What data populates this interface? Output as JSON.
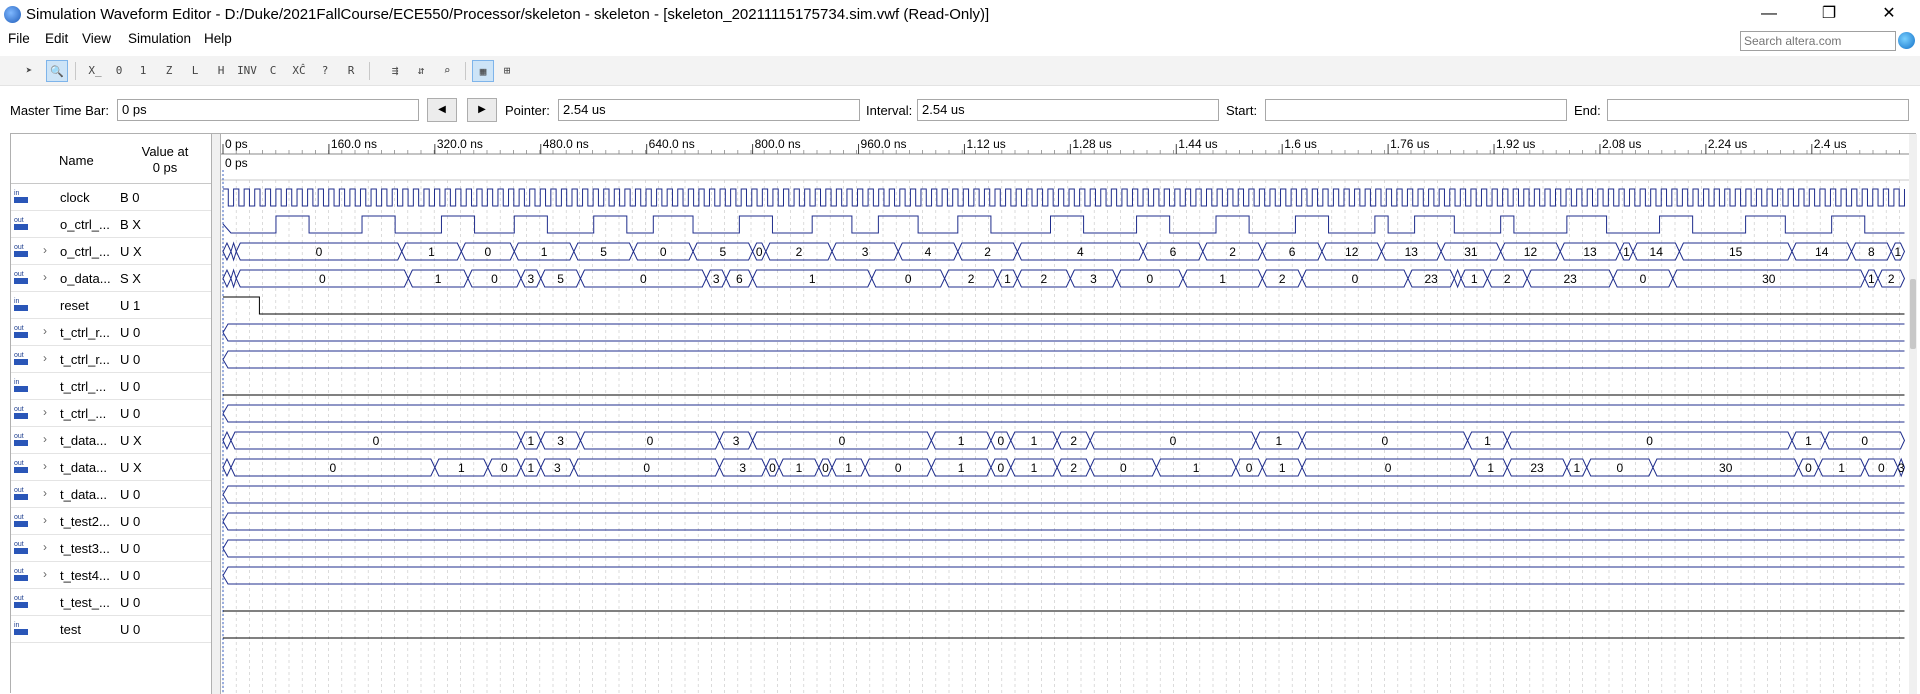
{
  "window": {
    "title": "Simulation Waveform Editor - D:/Duke/2021FallCourse/ECE550/Processor/skeleton - skeleton - [skeleton_20211115175734.sim.vwf (Read-Only)]",
    "icon": "simulator-app-icon",
    "controls": {
      "minimize": "—",
      "restore": "❐",
      "close": "✕"
    }
  },
  "menu": [
    "File",
    "Edit",
    "View",
    "Simulation",
    "Help"
  ],
  "search": {
    "placeholder": "Search altera.com"
  },
  "toolbar": [
    {
      "icon": "selection-tool-icon",
      "glyph": "➤",
      "active": false
    },
    {
      "icon": "zoom-tool-icon",
      "glyph": "🔍",
      "active": true
    },
    {
      "icon": "force-unknown-icon",
      "glyph": "X̲",
      "active": false
    },
    {
      "icon": "force-low-icon",
      "glyph": "0",
      "active": false
    },
    {
      "icon": "force-high-icon",
      "glyph": "1",
      "active": false
    },
    {
      "icon": "force-high-impedance-icon",
      "glyph": "Z",
      "active": false
    },
    {
      "icon": "weak-low-icon",
      "glyph": "L",
      "active": false
    },
    {
      "icon": "weak-high-icon",
      "glyph": "H",
      "active": false
    },
    {
      "icon": "invert-icon",
      "glyph": "INV",
      "active": false
    },
    {
      "icon": "count-value-icon",
      "glyph": "C",
      "active": false
    },
    {
      "icon": "clock-icon",
      "glyph": "XĈ",
      "active": false
    },
    {
      "icon": "arbitrary-value-icon",
      "glyph": "?",
      "active": false
    },
    {
      "icon": "random-value-icon",
      "glyph": "R",
      "active": false
    },
    {
      "icon": "snap-to-grid-icon",
      "glyph": "⇶",
      "active": false
    },
    {
      "icon": "sort-icon",
      "glyph": "⇵",
      "active": false
    },
    {
      "icon": "node-finder-icon",
      "glyph": "⌕",
      "active": false
    },
    {
      "icon": "run-functional-simulation-icon",
      "glyph": "▦",
      "active": true
    },
    {
      "icon": "run-timing-simulation-icon",
      "glyph": "⊞",
      "active": false
    }
  ],
  "timebar": {
    "master_label": "Master Time Bar:",
    "master_value": "0 ps",
    "pointer_label": "Pointer:",
    "pointer_value": "2.54 us",
    "interval_label": "Interval:",
    "interval_value": "2.54 us",
    "start_label": "Start:",
    "start_value": "",
    "end_label": "End:",
    "end_value": ""
  },
  "table": {
    "name_header": "Name",
    "value_header_line1": "Value at",
    "value_header_line2": "0 ps"
  },
  "ruler": {
    "labels": [
      "0 ps",
      "160.0 ns",
      "320.0 ns",
      "480.0 ns",
      "640.0 ns",
      "800.0 ns",
      "960.0 ns",
      "1.12 us",
      "1.28 us",
      "1.44 us",
      "1.6 us",
      "1.76 us",
      "1.92 us",
      "2.08 us",
      "2.24 us",
      "2.4 us",
      "2"
    ],
    "cursor_label": "0 ps"
  },
  "signals": [
    {
      "dir": "in",
      "name": "clock",
      "value": "B 0",
      "expandable": false
    },
    {
      "dir": "out",
      "name": "o_ctrl_...",
      "value": "B X",
      "expandable": false
    },
    {
      "dir": "out",
      "name": "o_ctrl_...",
      "value": "U X",
      "expandable": true
    },
    {
      "dir": "out",
      "name": "o_data...",
      "value": "S X",
      "expandable": true
    },
    {
      "dir": "in",
      "name": "reset",
      "value": "U 1",
      "expandable": false
    },
    {
      "dir": "out",
      "name": "t_ctrl_r...",
      "value": "U 0",
      "expandable": true
    },
    {
      "dir": "out",
      "name": "t_ctrl_r...",
      "value": "U 0",
      "expandable": true
    },
    {
      "dir": "in",
      "name": "t_ctrl_...",
      "value": "U 0",
      "expandable": false
    },
    {
      "dir": "out",
      "name": "t_ctrl_...",
      "value": "U 0",
      "expandable": true
    },
    {
      "dir": "out",
      "name": "t_data...",
      "value": "U X",
      "expandable": true
    },
    {
      "dir": "out",
      "name": "t_data...",
      "value": "U X",
      "expandable": true
    },
    {
      "dir": "out",
      "name": "t_data...",
      "value": "U 0",
      "expandable": true
    },
    {
      "dir": "out",
      "name": "t_test2...",
      "value": "U 0",
      "expandable": true
    },
    {
      "dir": "out",
      "name": "t_test3...",
      "value": "U 0",
      "expandable": true
    },
    {
      "dir": "out",
      "name": "t_test4...",
      "value": "U 0",
      "expandable": true
    },
    {
      "dir": "out",
      "name": "t_test_...",
      "value": "U 0",
      "expandable": false
    },
    {
      "dir": "in",
      "name": "test",
      "value": "U 0",
      "expandable": false
    }
  ],
  "waveforms": {
    "time_end_us": 2.54,
    "colors": {
      "wave": "#1f2d8c",
      "grid": "#c4c4c4",
      "line": "#000000"
    },
    "clock_cycles": 159,
    "clock_first_level": 1,
    "reset_high_until_us": 0.055,
    "ctrl_toggle_us": [
      0.08,
      0.13,
      0.21,
      0.26,
      0.33,
      0.38,
      0.44,
      0.49,
      0.56,
      0.61,
      0.65,
      0.71,
      0.78,
      0.83,
      0.89,
      0.95,
      0.99,
      1.05,
      1.11,
      1.16,
      1.25,
      1.3,
      1.38,
      1.43,
      1.5,
      1.55,
      1.62,
      1.67,
      1.74,
      1.76,
      1.8,
      1.86,
      1.93,
      1.95,
      2.03,
      2.09,
      2.17,
      2.22,
      2.3,
      2.36,
      2.43,
      2.48
    ],
    "buses": [
      {
        "row": 2,
        "segments": [
          [
            0.0,
            0.012,
            ""
          ],
          [
            0.012,
            0.02,
            ""
          ],
          [
            0.02,
            0.27,
            "0"
          ],
          [
            0.27,
            0.36,
            "1"
          ],
          [
            0.36,
            0.44,
            "0"
          ],
          [
            0.44,
            0.53,
            "1"
          ],
          [
            0.53,
            0.62,
            "5"
          ],
          [
            0.62,
            0.71,
            "0"
          ],
          [
            0.71,
            0.8,
            "5"
          ],
          [
            0.8,
            0.82,
            "0"
          ],
          [
            0.82,
            0.92,
            "2"
          ],
          [
            0.92,
            1.02,
            "3"
          ],
          [
            1.02,
            1.11,
            "4"
          ],
          [
            1.11,
            1.2,
            "2"
          ],
          [
            1.2,
            1.39,
            "4"
          ],
          [
            1.39,
            1.48,
            "6"
          ],
          [
            1.48,
            1.57,
            "2"
          ],
          [
            1.57,
            1.66,
            "6"
          ],
          [
            1.66,
            1.75,
            "12"
          ],
          [
            1.75,
            1.84,
            "13"
          ],
          [
            1.84,
            1.93,
            "31"
          ],
          [
            1.93,
            2.02,
            "12"
          ],
          [
            2.02,
            2.11,
            "13"
          ],
          [
            2.11,
            2.13,
            "1"
          ],
          [
            2.13,
            2.2,
            "14"
          ],
          [
            2.2,
            2.37,
            "15"
          ],
          [
            2.37,
            2.46,
            "14"
          ],
          [
            2.46,
            2.52,
            "8"
          ],
          [
            2.52,
            2.54,
            "1"
          ]
        ]
      },
      {
        "row": 3,
        "segments": [
          [
            0.0,
            0.012,
            ""
          ],
          [
            0.012,
            0.02,
            ""
          ],
          [
            0.02,
            0.28,
            "0"
          ],
          [
            0.28,
            0.37,
            "1"
          ],
          [
            0.37,
            0.45,
            "0"
          ],
          [
            0.45,
            0.48,
            "3"
          ],
          [
            0.48,
            0.54,
            "5"
          ],
          [
            0.54,
            0.73,
            "0"
          ],
          [
            0.73,
            0.76,
            "3"
          ],
          [
            0.76,
            0.8,
            "6"
          ],
          [
            0.8,
            0.98,
            "1"
          ],
          [
            0.98,
            1.09,
            "0"
          ],
          [
            1.09,
            1.17,
            "2"
          ],
          [
            1.17,
            1.2,
            "1"
          ],
          [
            1.2,
            1.28,
            "2"
          ],
          [
            1.28,
            1.35,
            "3"
          ],
          [
            1.35,
            1.45,
            "0"
          ],
          [
            1.45,
            1.57,
            "1"
          ],
          [
            1.57,
            1.63,
            "2"
          ],
          [
            1.63,
            1.79,
            "0"
          ],
          [
            1.79,
            1.86,
            "23"
          ],
          [
            1.86,
            1.87,
            ""
          ],
          [
            1.87,
            1.91,
            "1"
          ],
          [
            1.91,
            1.97,
            "2"
          ],
          [
            1.97,
            2.1,
            "23"
          ],
          [
            2.1,
            2.19,
            "0"
          ],
          [
            2.19,
            2.48,
            "30"
          ],
          [
            2.48,
            2.5,
            "1"
          ],
          [
            2.5,
            2.54,
            "2"
          ]
        ]
      },
      {
        "row": 9,
        "segments": [
          [
            0.0,
            0.012,
            ""
          ],
          [
            0.012,
            0.45,
            "0"
          ],
          [
            0.45,
            0.48,
            "1"
          ],
          [
            0.48,
            0.54,
            "3"
          ],
          [
            0.54,
            0.75,
            "0"
          ],
          [
            0.75,
            0.8,
            "3"
          ],
          [
            0.8,
            1.07,
            "0"
          ],
          [
            1.07,
            1.16,
            "1"
          ],
          [
            1.16,
            1.19,
            "0"
          ],
          [
            1.19,
            1.26,
            "1"
          ],
          [
            1.26,
            1.31,
            "2"
          ],
          [
            1.31,
            1.56,
            "0"
          ],
          [
            1.56,
            1.63,
            "1"
          ],
          [
            1.63,
            1.88,
            "0"
          ],
          [
            1.88,
            1.94,
            "1"
          ],
          [
            1.94,
            2.37,
            "0"
          ],
          [
            2.37,
            2.42,
            "1"
          ],
          [
            2.42,
            2.54,
            "0"
          ]
        ]
      },
      {
        "row": 10,
        "segments": [
          [
            0.0,
            0.012,
            ""
          ],
          [
            0.012,
            0.32,
            "0"
          ],
          [
            0.32,
            0.4,
            "1"
          ],
          [
            0.4,
            0.45,
            "0"
          ],
          [
            0.45,
            0.48,
            "1"
          ],
          [
            0.48,
            0.53,
            "3"
          ],
          [
            0.53,
            0.75,
            "0"
          ],
          [
            0.75,
            0.82,
            "3"
          ],
          [
            0.82,
            0.84,
            "0"
          ],
          [
            0.84,
            0.9,
            "1"
          ],
          [
            0.9,
            0.92,
            "0"
          ],
          [
            0.92,
            0.97,
            "1"
          ],
          [
            0.97,
            1.07,
            "0"
          ],
          [
            1.07,
            1.16,
            "1"
          ],
          [
            1.16,
            1.19,
            "0"
          ],
          [
            1.19,
            1.26,
            "1"
          ],
          [
            1.26,
            1.31,
            "2"
          ],
          [
            1.31,
            1.41,
            "0"
          ],
          [
            1.41,
            1.53,
            "1"
          ],
          [
            1.53,
            1.57,
            "0"
          ],
          [
            1.57,
            1.63,
            "1"
          ],
          [
            1.63,
            1.89,
            "0"
          ],
          [
            1.89,
            1.94,
            "1"
          ],
          [
            1.94,
            2.03,
            "23"
          ],
          [
            2.03,
            2.06,
            "1"
          ],
          [
            2.06,
            2.16,
            "0"
          ],
          [
            2.16,
            2.38,
            "30"
          ],
          [
            2.38,
            2.41,
            "0"
          ],
          [
            2.41,
            2.48,
            "1"
          ],
          [
            2.48,
            2.53,
            "0"
          ],
          [
            2.53,
            2.54,
            "3"
          ]
        ]
      }
    ]
  }
}
